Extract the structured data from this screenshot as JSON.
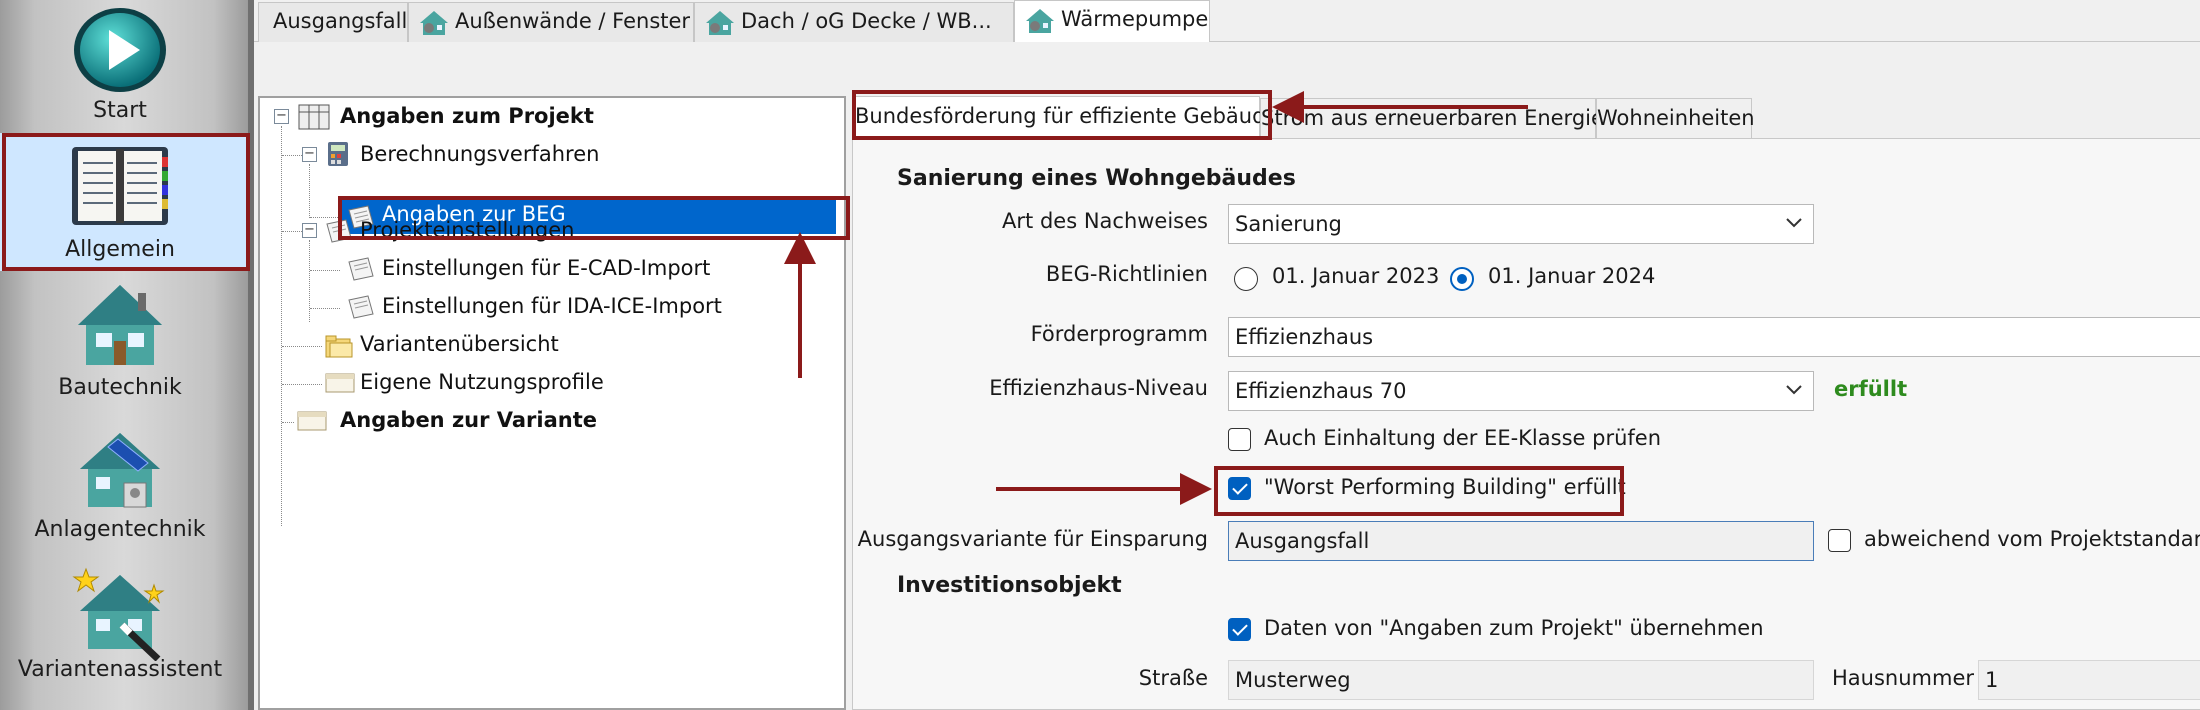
{
  "sidebar": {
    "items": [
      {
        "label": "Start",
        "icon": "play-icon"
      },
      {
        "label": "Allgemein",
        "icon": "book-icon"
      },
      {
        "label": "Bautechnik",
        "icon": "house-icon"
      },
      {
        "label": "Anlagentechnik",
        "icon": "house-solar-icon"
      },
      {
        "label": "Variantenassistent",
        "icon": "house-wand-icon"
      }
    ]
  },
  "top_tabs": [
    {
      "label": "Ausgangsfall"
    },
    {
      "label": "Außenwände / Fenster"
    },
    {
      "label": "Dach / oG Decke / WB..."
    },
    {
      "label": "Wärmepumpe"
    }
  ],
  "tree": {
    "root": "Angaben zum Projekt",
    "berechnungsverfahren": "Berechnungsverfahren",
    "angaben_beg": "Angaben zur BEG",
    "projekteinstellungen": "Projekteinstellungen",
    "ecad": "Einstellungen für E-CAD-Import",
    "idaice": "Einstellungen für IDA-ICE-Import",
    "varianten": "Variantenübersicht",
    "nutzungsprofile": "Eigene Nutzungsprofile",
    "variante": "Angaben zur Variante"
  },
  "sub_tabs": [
    {
      "label": "Bundesförderung für effiziente Gebäude"
    },
    {
      "label": "Strom aus erneuerbaren Energien"
    },
    {
      "label": "Wohneinheiten"
    }
  ],
  "form": {
    "section1_title": "Sanierung eines Wohngebäudes",
    "art_label": "Art des Nachweises",
    "art_value": "Sanierung",
    "beg_label": "BEG-Richtlinien",
    "beg_option1": "01. Januar 2023",
    "beg_option2": "01. Januar 2024",
    "foerder_label": "Förderprogramm",
    "foerder_value": "Effizienzhaus",
    "eh_label": "Effizienzhaus-Niveau",
    "eh_value": "Effizienzhaus 70",
    "eh_status": "erfüllt",
    "ee_check_label": "Auch Einhaltung der EE-Klasse prüfen",
    "wpb_check_label": "\"Worst Performing Building\" erfüllt",
    "ausgang_label": "Ausgangsvariante für Einsparung",
    "ausgang_value": "Ausgangsfall",
    "abweichend_label": "abweichend vom Projektstandard",
    "section2_title": "Investitionsobjekt",
    "daten_check_label": "Daten von \"Angaben zum Projekt\" übernehmen",
    "strasse_label": "Straße",
    "strasse_value": "Musterweg",
    "hausnr_label": "Hausnummer",
    "hausnr_value": "1"
  },
  "colors": {
    "accent": "#0060c0",
    "annotation": "#8b1a1a",
    "status_ok": "#2e8b1e",
    "selection": "#0066cc"
  }
}
